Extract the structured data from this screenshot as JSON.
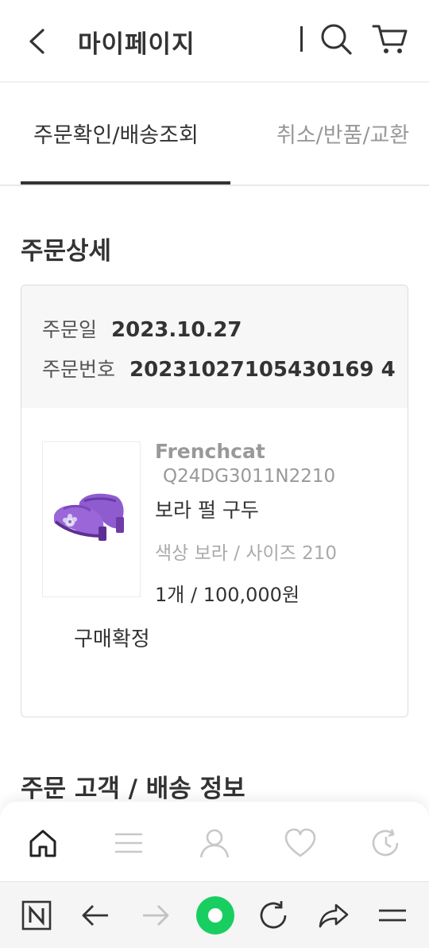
{
  "header": {
    "title": "마이페이지",
    "back_icon": "back-arrow-icon",
    "search_icon": "search-icon",
    "cart_icon": "cart-icon"
  },
  "tabs": [
    {
      "label": "주문확인/배송조회",
      "active": true
    },
    {
      "label": "취소/반품/교환",
      "active": false
    }
  ],
  "order_detail": {
    "section_title": "주문상세",
    "order_date_label": "주문일",
    "order_date": "2023.10.27",
    "order_number_label": "주문번호",
    "order_number": "20231027105430169 4",
    "product": {
      "image_icon": "purple-shoes-image",
      "brand": "Frenchcat",
      "code": "Q24DG3011N2210",
      "name": "보라 펄 구두",
      "option": "색상 보라 / 사이즈 210",
      "quantity_price": "1개 / 100,000원"
    },
    "confirm_label": "구매확정"
  },
  "customer_section_title": "주문 고객 / 배송 정보",
  "bottom_nav": [
    {
      "icon": "home-icon",
      "active": true
    },
    {
      "icon": "menu-icon",
      "active": false
    },
    {
      "icon": "user-icon",
      "active": false
    },
    {
      "icon": "heart-icon",
      "active": false
    },
    {
      "icon": "recent-history-icon",
      "active": false
    }
  ],
  "browser_toolbar": [
    {
      "icon": "naver-n-icon"
    },
    {
      "icon": "back-arrow-icon"
    },
    {
      "icon": "forward-arrow-icon"
    },
    {
      "icon": "green-home-circle-icon"
    },
    {
      "icon": "refresh-icon"
    },
    {
      "icon": "share-icon"
    },
    {
      "icon": "menu-icon"
    }
  ],
  "colors": {
    "text": "#333333",
    "muted": "#999999",
    "card_head_bg": "#f7f7f7",
    "accent_green": "#19ce60"
  }
}
